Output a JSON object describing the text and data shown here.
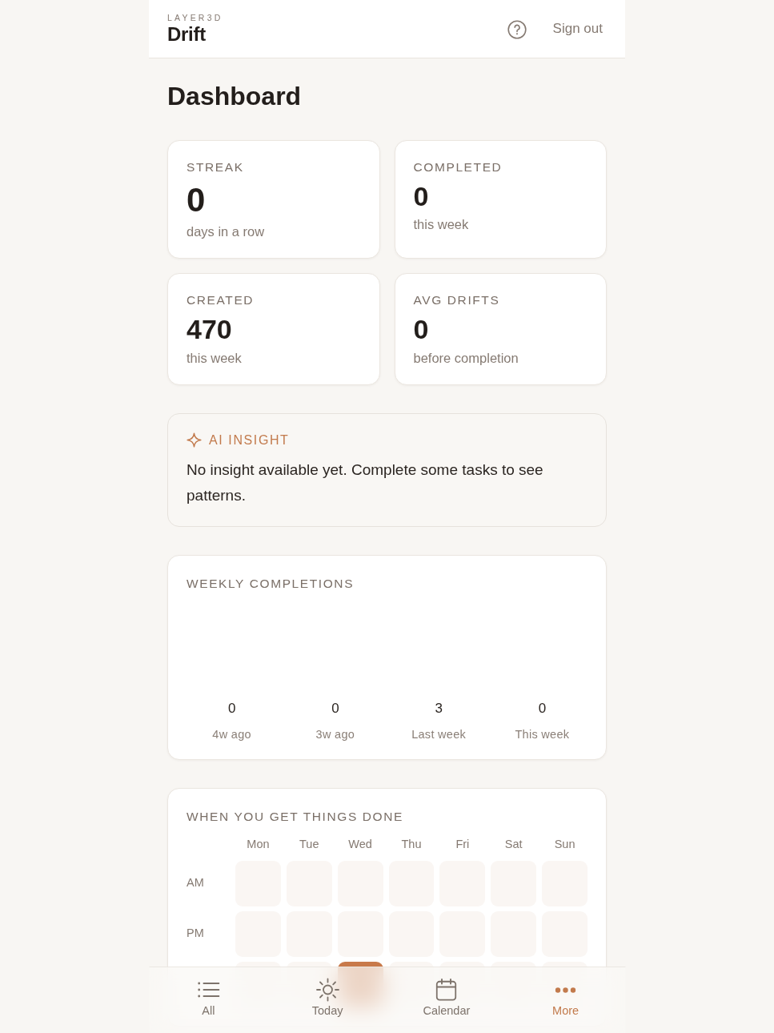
{
  "header": {
    "brand": "LAYER3D",
    "app_name": "Drift",
    "sign_out": "Sign out"
  },
  "page_title": "Dashboard",
  "stats": [
    {
      "kind": "hero",
      "label": "STREAK",
      "value": "0",
      "caption": "days in a row"
    },
    {
      "kind": "count",
      "label": "COMPLETED",
      "value": "0",
      "caption": "this week"
    },
    {
      "kind": "count",
      "label": "CREATED",
      "value": "470",
      "caption": "this week"
    },
    {
      "kind": "count",
      "label": "AVG DRIFTS",
      "value": "0",
      "caption": "before completion"
    }
  ],
  "insight": {
    "title": "AI INSIGHT",
    "text": "No insight available yet. Complete some tasks to see patterns."
  },
  "weekly_completions": {
    "title": "WEEKLY COMPLETIONS",
    "weeks": [
      {
        "count": "0",
        "label": "4w ago"
      },
      {
        "count": "0",
        "label": "3w ago"
      },
      {
        "count": "3",
        "label": "Last week"
      },
      {
        "count": "0",
        "label": "This week"
      }
    ]
  },
  "heatmap": {
    "title": "WHEN YOU GET THINGS DONE",
    "days": [
      "Mon",
      "Tue",
      "Wed",
      "Thu",
      "Fri",
      "Sat",
      "Sun"
    ],
    "rows": [
      {
        "label": "AM",
        "cells": [
          {
            "color": "#faf6f3"
          },
          {
            "color": "#faf6f3"
          },
          {
            "color": "#faf6f3"
          },
          {
            "color": "#faf6f3"
          },
          {
            "color": "#faf6f3"
          },
          {
            "color": "#faf6f3"
          },
          {
            "color": "#faf6f3"
          }
        ]
      },
      {
        "label": "PM",
        "cells": [
          {
            "color": "#faf6f3"
          },
          {
            "color": "#faf6f3"
          },
          {
            "color": "#faf6f3"
          },
          {
            "color": "#faf6f3"
          },
          {
            "color": "#faf6f3"
          },
          {
            "color": "#faf6f3"
          },
          {
            "color": "#faf6f3"
          }
        ]
      },
      {
        "cells": [
          {
            "color": "#faf6f3"
          },
          {
            "color": "#faf6f3"
          },
          {
            "color": "#c8794a"
          },
          {
            "color": "#faf6f3"
          },
          {
            "color": "#faf6f3"
          },
          {
            "color": "#faf6f3"
          },
          {
            "color": "#faf6f3"
          }
        ]
      }
    ]
  },
  "bottom_nav": [
    {
      "label": "All",
      "selected": false
    },
    {
      "label": "Today",
      "selected": false
    },
    {
      "label": "Calendar",
      "selected": false
    },
    {
      "label": "More",
      "selected": true
    }
  ]
}
